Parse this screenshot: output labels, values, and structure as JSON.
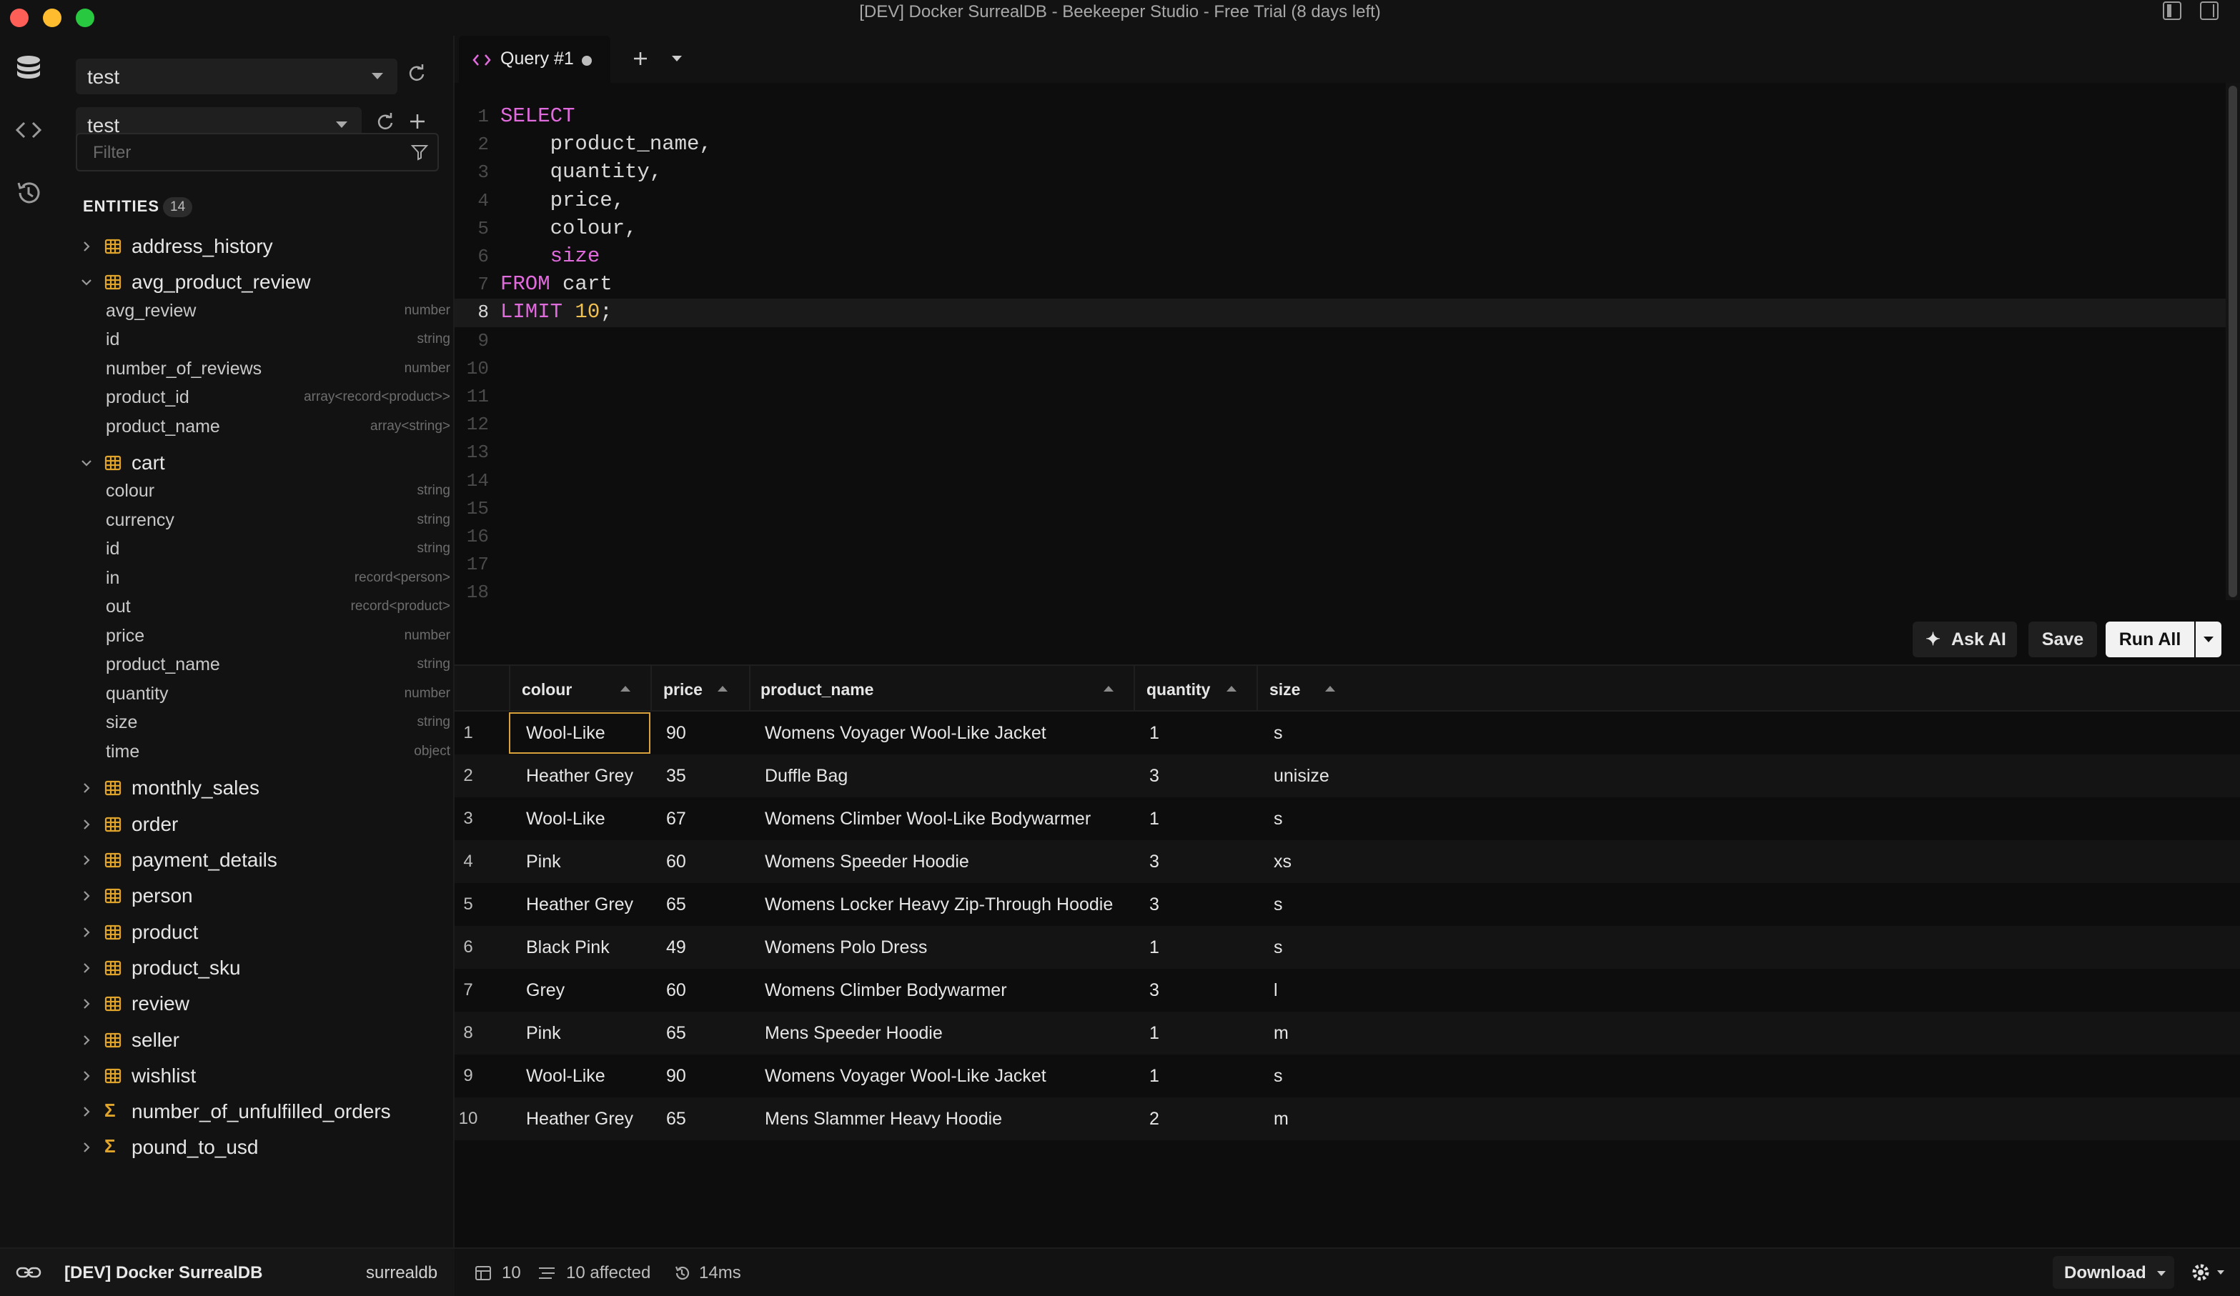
{
  "window": {
    "title": "[DEV] Docker SurrealDB - Beekeeper Studio - Free Trial (8 days left)",
    "traffic_colors": [
      "#ff5f57",
      "#febc2e",
      "#28c840"
    ]
  },
  "activity_bar": {
    "icons": [
      "database-icon",
      "code-icon",
      "history-icon"
    ]
  },
  "sidebar": {
    "namespace_select": "test",
    "database_select": "test",
    "filter_placeholder": "Filter",
    "entities_label": "ENTITIES",
    "entities_count": "14",
    "tree": [
      {
        "label": "address_history",
        "kind": "table",
        "expanded": false
      },
      {
        "label": "avg_product_review",
        "kind": "table",
        "expanded": true,
        "columns": [
          {
            "name": "avg_review",
            "type": "number"
          },
          {
            "name": "id",
            "type": "string"
          },
          {
            "name": "number_of_reviews",
            "type": "number"
          },
          {
            "name": "product_id",
            "type": "array<record<product>>"
          },
          {
            "name": "product_name",
            "type": "array<string>"
          }
        ]
      },
      {
        "label": "cart",
        "kind": "table",
        "expanded": true,
        "columns": [
          {
            "name": "colour",
            "type": "string"
          },
          {
            "name": "currency",
            "type": "string"
          },
          {
            "name": "id",
            "type": "string"
          },
          {
            "name": "in",
            "type": "record<person>"
          },
          {
            "name": "out",
            "type": "record<product>"
          },
          {
            "name": "price",
            "type": "number"
          },
          {
            "name": "product_name",
            "type": "string"
          },
          {
            "name": "quantity",
            "type": "number"
          },
          {
            "name": "size",
            "type": "string"
          },
          {
            "name": "time",
            "type": "object"
          }
        ]
      },
      {
        "label": "monthly_sales",
        "kind": "table",
        "expanded": false
      },
      {
        "label": "order",
        "kind": "table",
        "expanded": false
      },
      {
        "label": "payment_details",
        "kind": "table",
        "expanded": false
      },
      {
        "label": "person",
        "kind": "table",
        "expanded": false
      },
      {
        "label": "product",
        "kind": "table",
        "expanded": false
      },
      {
        "label": "product_sku",
        "kind": "table",
        "expanded": false
      },
      {
        "label": "review",
        "kind": "table",
        "expanded": false
      },
      {
        "label": "seller",
        "kind": "table",
        "expanded": false
      },
      {
        "label": "wishlist",
        "kind": "table",
        "expanded": false
      },
      {
        "label": "number_of_unfulfilled_orders",
        "kind": "function",
        "expanded": false
      },
      {
        "label": "pound_to_usd",
        "kind": "function",
        "expanded": false
      }
    ]
  },
  "tabs": {
    "active_label": "Query #1",
    "add_icon": "plus-icon",
    "menu_icon": "chevron-down-icon"
  },
  "editor": {
    "lines": [
      {
        "n": "1",
        "html": "<span class=\"kw\">SELECT</span>"
      },
      {
        "n": "2",
        "html": "    product_name,"
      },
      {
        "n": "3",
        "html": "    quantity,"
      },
      {
        "n": "4",
        "html": "    price,"
      },
      {
        "n": "5",
        "html": "    colour,"
      },
      {
        "n": "6",
        "html": "    <span class=\"kw\">size</span>"
      },
      {
        "n": "7",
        "html": "<span class=\"kw\">FROM</span> cart"
      },
      {
        "n": "8",
        "html": "<span class=\"kw\">LIMIT</span> <span class=\"num\">10</span>;"
      },
      {
        "n": "9",
        "html": ""
      },
      {
        "n": "10",
        "html": ""
      },
      {
        "n": "11",
        "html": ""
      },
      {
        "n": "12",
        "html": ""
      },
      {
        "n": "13",
        "html": ""
      },
      {
        "n": "14",
        "html": ""
      },
      {
        "n": "15",
        "html": ""
      },
      {
        "n": "16",
        "html": ""
      },
      {
        "n": "17",
        "html": ""
      },
      {
        "n": "18",
        "html": ""
      }
    ],
    "active_line": "8",
    "keyword_color": "#e06bdc",
    "number_color": "#f0c050"
  },
  "toolbar": {
    "ask_ai_label": "Ask AI",
    "save_label": "Save",
    "run_all_label": "Run All"
  },
  "results": {
    "columns": [
      "colour",
      "price",
      "product_name",
      "quantity",
      "size"
    ],
    "rows": [
      [
        "Wool-Like",
        "90",
        "Womens Voyager Wool-Like Jacket",
        "1",
        "s"
      ],
      [
        "Heather Grey",
        "35",
        "Duffle Bag",
        "3",
        "unisize"
      ],
      [
        "Wool-Like",
        "67",
        "Womens Climber Wool-Like Bodywarmer",
        "1",
        "s"
      ],
      [
        "Pink",
        "60",
        "Womens Speeder Hoodie",
        "3",
        "xs"
      ],
      [
        "Heather Grey",
        "65",
        "Womens Locker Heavy Zip-Through Hoodie",
        "3",
        "s"
      ],
      [
        "Black Pink",
        "49",
        "Womens Polo Dress",
        "1",
        "s"
      ],
      [
        "Grey",
        "60",
        "Womens Climber Bodywarmer",
        "3",
        "l"
      ],
      [
        "Pink",
        "65",
        "Mens Speeder Hoodie",
        "1",
        "m"
      ],
      [
        "Wool-Like",
        "90",
        "Womens Voyager Wool-Like Jacket",
        "1",
        "s"
      ],
      [
        "Heather Grey",
        "65",
        "Mens Slammer Heavy Hoodie",
        "2",
        "m"
      ]
    ],
    "selection_color": "#d9a23a"
  },
  "statusbar": {
    "connection_name": "[DEV] Docker SurrealDB",
    "connection_type": "surrealdb",
    "row_count": "10",
    "affected": "10 affected",
    "duration": "14ms",
    "download_label": "Download"
  }
}
